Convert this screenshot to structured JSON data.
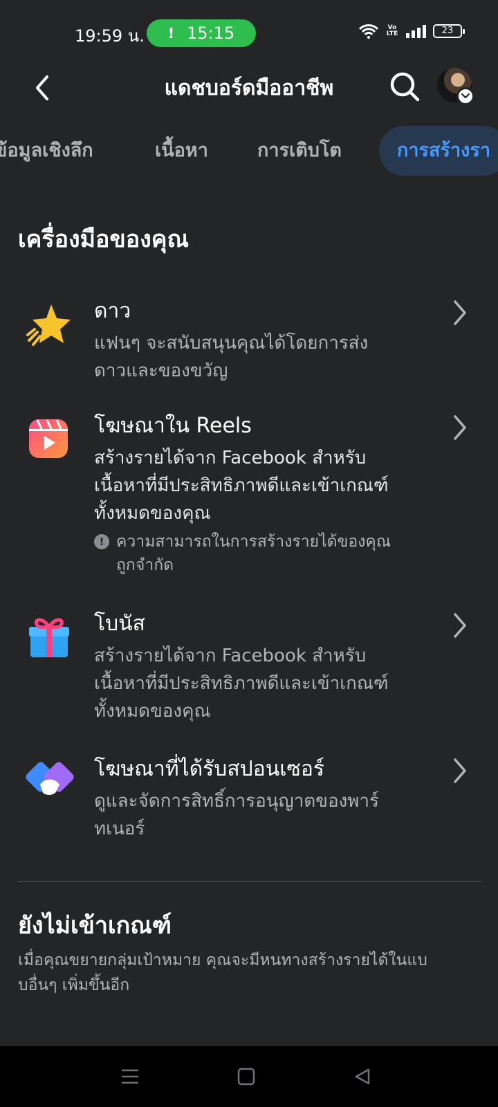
{
  "status_bar": {
    "time": "19:59 น.",
    "call_time": "15:15",
    "call_icon": "!",
    "volte": "Vo LTE",
    "battery": "23"
  },
  "header": {
    "title": "แดชบอร์ดมืออาชีพ",
    "back_icon": "chevron-left-icon",
    "search_icon": "search-icon"
  },
  "tabs": [
    {
      "label": "ข้อมูลเชิงลึก",
      "active": false
    },
    {
      "label": "เนื้อหา",
      "active": false
    },
    {
      "label": "การเติบโต",
      "active": false
    },
    {
      "label": "การสร้างรา",
      "active": true
    }
  ],
  "tools_section": {
    "title": "เครื่องมือของคุณ",
    "items": [
      {
        "icon": "star-icon",
        "title": "ดาว",
        "desc_lines": [
          "แฟนๆ จะสนับสนุนคุณได้โดยการส่ง",
          "ดาวและของขวัญ"
        ]
      },
      {
        "icon": "reels-icon",
        "title": "โฆษณาใน Reels",
        "desc_lines": [
          "สร้างรายได้จาก Facebook สำหรับ",
          "เนื้อหาที่มีประสิทธิภาพดีและเข้าเกณฑ์",
          "ทั้งหมดของคุณ"
        ],
        "warning_lines": [
          "ความสามารถในการสร้างรายได้ของคุณ",
          "ถูกจำกัด"
        ],
        "warning_icon": "!"
      },
      {
        "icon": "gift-icon",
        "title": "โบนัส",
        "desc_lines": [
          "สร้างรายได้จาก Facebook สำหรับ",
          "เนื้อหาที่มีประสิทธิภาพดีและเข้าเกณฑ์",
          "ทั้งหมดของคุณ"
        ]
      },
      {
        "icon": "handshake-icon",
        "title": "โฆษณาที่ได้รับสปอนเซอร์",
        "desc_lines": [
          "ดูและจัดการสิทธิ์การอนุญาตของพาร์",
          "ทเนอร์"
        ]
      }
    ]
  },
  "not_eligible_section": {
    "title": "ยังไม่เข้าเกณฑ์",
    "desc_lines": [
      "เมื่อคุณขยายกลุ่มเป้าหมาย คุณจะมีหนทางสร้างรายได้ในแบ",
      "บอื่นๆ เพิ่มขึ้นอีก"
    ]
  },
  "colors": {
    "background": "#242526",
    "accent": "#4599ff",
    "active_tab_bg": "#263951",
    "call_pill": "#2dbe4e"
  }
}
